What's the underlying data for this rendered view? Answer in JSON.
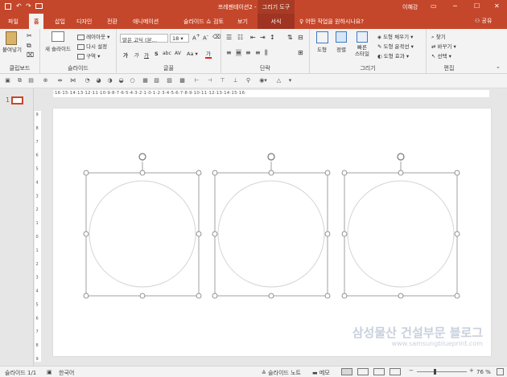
{
  "window": {
    "title": "프레젠테이션2 - PowerPoint",
    "user": "이혜강",
    "controls": [
      "▭",
      "─",
      "☐",
      "✕"
    ]
  },
  "context_tab": {
    "group": "그리기 도구",
    "tab": "서식"
  },
  "tabs": [
    "파일",
    "홈",
    "삽입",
    "디자인",
    "전환",
    "애니메이션",
    "슬라이드 쇼",
    "검토",
    "보기"
  ],
  "tell_me": "어떤 작업을 원하시나요?",
  "share": "공유",
  "ribbon": {
    "clipboard": {
      "label": "클립보드",
      "paste": "붙여넣기"
    },
    "slides": {
      "label": "슬라이드",
      "new_slide": "새 슬라이드",
      "layout": "레이아웃",
      "reset": "다시 설정",
      "section": "구역"
    },
    "font": {
      "label": "글꼴",
      "font_name": "맑은 고딕 (본…",
      "font_size": "18",
      "bold": "가",
      "italic": "가",
      "underline": "가",
      "strike": "S",
      "shadow": "abc",
      "spacing": "AV",
      "case": "Aa",
      "color": "가"
    },
    "paragraph": {
      "label": "단락"
    },
    "drawing": {
      "label": "그리기",
      "shapes": "도형",
      "arrange": "정렬",
      "quick_styles": "빠른\n스타일",
      "fill": "도형 채우기",
      "outline": "도형 윤곽선",
      "effects": "도형 효과"
    },
    "editing": {
      "label": "편집",
      "find": "찾기",
      "replace": "바꾸기",
      "select": "선택"
    }
  },
  "thumbnail": {
    "number": "1"
  },
  "hruler_text": "·16·15·14·13·12·11·10·9·8·7·6·5·4·3·2·1·0·1·2·3·4·5·6·7·8·9·10·11·12·13·14·15·16·",
  "vruler_text": [
    "9",
    "8",
    "7",
    "6",
    "5",
    "4",
    "3",
    "2",
    "1",
    "0",
    "1",
    "2",
    "3",
    "4",
    "5",
    "6",
    "7",
    "8",
    "9"
  ],
  "watermark": {
    "title": "삼성물산 건설부문 블로그",
    "url": "www.samsungblueprint.com"
  },
  "status": {
    "slide": "슬라이드 1/1",
    "language": "한국어",
    "notes": "슬라이드 노트",
    "comments": "메모",
    "zoom": "76 %",
    "zoom_level": 0.76
  }
}
